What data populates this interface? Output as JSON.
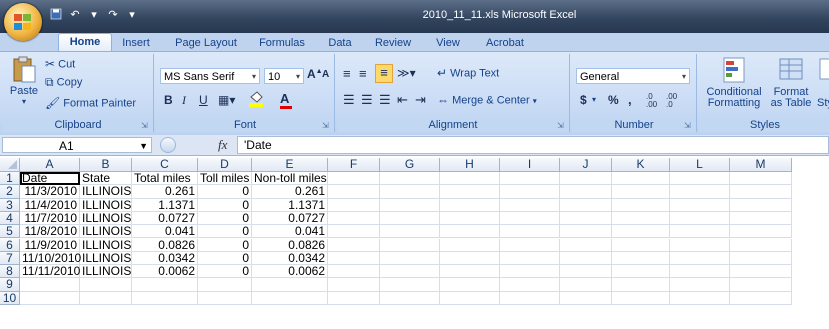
{
  "window": {
    "title": "2010_11_11.xls  Microsoft Excel"
  },
  "quick_access": {
    "icons": [
      "save-icon",
      "undo-icon",
      "redo-icon",
      "customize-icon"
    ]
  },
  "tabs": [
    "Home",
    "Insert",
    "Page Layout",
    "Formulas",
    "Data",
    "Review",
    "View",
    "Acrobat"
  ],
  "ribbon": {
    "clipboard": {
      "paste": "Paste",
      "cut": "Cut",
      "copy": "Copy",
      "format_painter": "Format Painter",
      "label": "Clipboard"
    },
    "font": {
      "family": "MS Sans Serif",
      "size": "10",
      "bold": "B",
      "italic": "I",
      "underline": "U",
      "label": "Font"
    },
    "alignment": {
      "wrap_text": "Wrap Text",
      "merge_center": "Merge & Center",
      "label": "Alignment"
    },
    "number": {
      "format": "General",
      "currency": "$",
      "percent": "%",
      "comma": ",",
      "label": "Number"
    },
    "styles": {
      "conditional": "Conditional",
      "conditional2": "Formatting",
      "format_as": "Format",
      "format_as2": "as Table",
      "cell_styles": "Sty",
      "label": "Styles"
    }
  },
  "formula_bar": {
    "name_box": "A1",
    "fx": "fx",
    "content": "'Date"
  },
  "columns": [
    "A",
    "B",
    "C",
    "D",
    "E",
    "F",
    "G",
    "H",
    "I",
    "J",
    "K",
    "L",
    "M"
  ],
  "rows": [
    "1",
    "2",
    "3",
    "4",
    "5",
    "6",
    "7",
    "8",
    "9",
    "10"
  ],
  "sheet": {
    "headers": [
      "Date",
      "State",
      "Total miles",
      "Toll miles",
      "Non-toll miles"
    ],
    "data": [
      [
        "11/3/2010",
        "ILLINOIS",
        "0.261",
        "0",
        "0.261"
      ],
      [
        "11/4/2010",
        "ILLINOIS",
        "1.1371",
        "0",
        "1.1371"
      ],
      [
        "11/7/2010",
        "ILLINOIS",
        "0.0727",
        "0",
        "0.0727"
      ],
      [
        "11/8/2010",
        "ILLINOIS",
        "0.041",
        "0",
        "0.041"
      ],
      [
        "11/9/2010",
        "ILLINOIS",
        "0.0826",
        "0",
        "0.0826"
      ],
      [
        "11/10/2010",
        "ILLINOIS",
        "0.0342",
        "0",
        "0.0342"
      ],
      [
        "11/11/2010",
        "ILLINOIS",
        "0.0062",
        "0",
        "0.0062"
      ]
    ]
  },
  "colors": {
    "ribbon": "#c7daf4",
    "titlebar": "#33465f",
    "text": "#15428b"
  }
}
